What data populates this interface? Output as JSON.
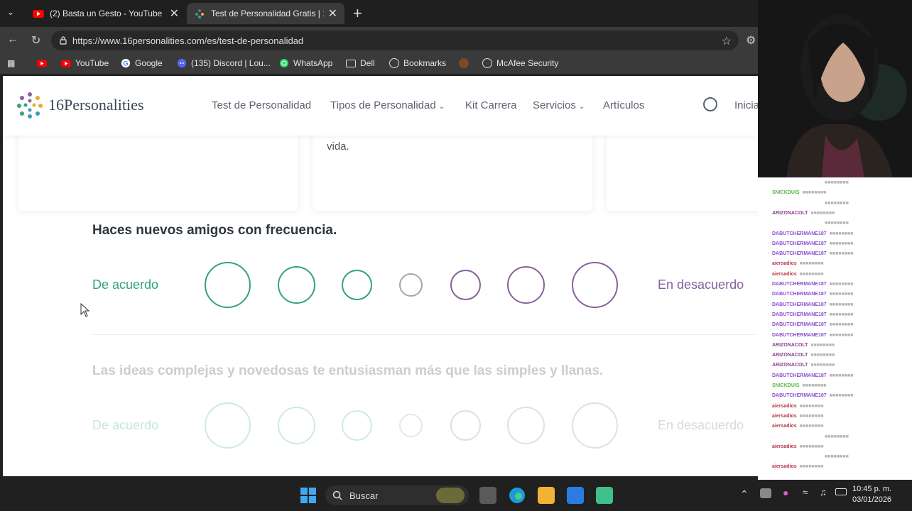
{
  "browser": {
    "tabs": [
      {
        "title": "(2) Basta un Gesto - YouTube",
        "active": false
      },
      {
        "title": "Test de Personalidad Gratis | 16Per",
        "active": true
      }
    ],
    "url": "https://www.16personalities.com/es/test-de-personalidad",
    "bookmarks": [
      "YouTube",
      "Google",
      "(135) Discord | Lou...",
      "WhatsApp",
      "Dell",
      "Bookmarks",
      "McAfee Security"
    ]
  },
  "site": {
    "logo": "16Personalities",
    "nav": [
      "Test de Personalidad",
      "Tipos de Personalidad",
      "Kit Carrera",
      "Servicios",
      "Artículos",
      "Inicia"
    ],
    "card_text": "vida."
  },
  "questions": [
    {
      "text": "Haces nuevos amigos con frecuencia.",
      "agree": "De acuerdo",
      "disagree": "En desacuerdo"
    },
    {
      "text": "Las ideas complejas y novedosas te entusiasman más que las simples y llanas.",
      "agree": "De acuerdo",
      "disagree": "En desacuerdo"
    }
  ],
  "colors": {
    "agree": "#33a474",
    "disagree": "#88619a",
    "neutral": "#9fa6ad"
  },
  "chat": [
    {
      "user": "",
      "color": "#888888"
    },
    {
      "user": "SNICKDUIS",
      "color": "#57b846"
    },
    {
      "user": "",
      "color": "#888888"
    },
    {
      "user": "ARIZONACOLT",
      "color": "#8b3f8f"
    },
    {
      "user": "",
      "color": "#888888"
    },
    {
      "user": "DABUTCHERMANE187",
      "color": "#8a4fd0"
    },
    {
      "user": "DABUTCHERMANE187",
      "color": "#8a4fd0"
    },
    {
      "user": "DABUTCHERMANE187",
      "color": "#8a4fd0"
    },
    {
      "user": "aiersadios",
      "color": "#b8364c"
    },
    {
      "user": "aiersadios",
      "color": "#b8364c"
    },
    {
      "user": "DABUTCHERMANE187",
      "color": "#8a4fd0"
    },
    {
      "user": "DABUTCHERMANE187",
      "color": "#8a4fd0"
    },
    {
      "user": "DABUTCHERMANE187",
      "color": "#8a4fd0"
    },
    {
      "user": "DABUTCHERMANE187",
      "color": "#8a4fd0"
    },
    {
      "user": "DABUTCHERMANE187",
      "color": "#8a4fd0"
    },
    {
      "user": "DABUTCHERMANE187",
      "color": "#8a4fd0"
    },
    {
      "user": "ARIZONACOLT",
      "color": "#8b3f8f"
    },
    {
      "user": "ARIZONACOLT",
      "color": "#8b3f8f"
    },
    {
      "user": "ARIZONACOLT",
      "color": "#8b3f8f"
    },
    {
      "user": "DABUTCHERMANE187",
      "color": "#8a4fd0"
    },
    {
      "user": "SNICKDUIS",
      "color": "#57b846"
    },
    {
      "user": "DABUTCHERMANE187",
      "color": "#8a4fd0"
    },
    {
      "user": "aiersadios",
      "color": "#b8364c"
    },
    {
      "user": "aiersadios",
      "color": "#b8364c"
    },
    {
      "user": "aiersadios",
      "color": "#b8364c"
    },
    {
      "user": "",
      "color": "#888888"
    },
    {
      "user": "aiersadios",
      "color": "#b8364c"
    },
    {
      "user": "",
      "color": "#888888"
    },
    {
      "user": "aiersadios",
      "color": "#b8364c"
    }
  ],
  "taskbar": {
    "search_placeholder": "Buscar",
    "time": "10:45 p. m.",
    "date": "03/01/2026"
  }
}
